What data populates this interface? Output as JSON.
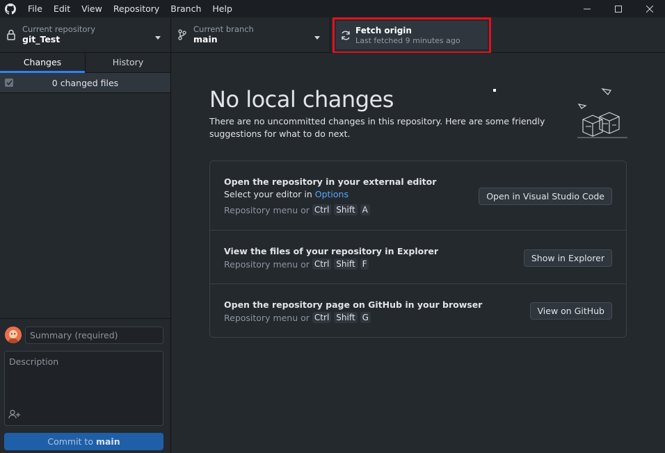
{
  "menu": [
    "File",
    "Edit",
    "View",
    "Repository",
    "Branch",
    "Help"
  ],
  "toolbar": {
    "repo_label": "Current repository",
    "repo_value": "git_Test",
    "branch_label": "Current branch",
    "branch_value": "main",
    "fetch_label": "Fetch origin",
    "fetch_sub": "Last fetched 9 minutes ago"
  },
  "sidebar": {
    "tabs": [
      "Changes",
      "History"
    ],
    "changed_files": "0 changed files",
    "summary_placeholder": "Summary (required)",
    "description_placeholder": "Description",
    "commit_prefix": "Commit to ",
    "commit_branch": "main"
  },
  "main": {
    "title": "No local changes",
    "subtitle": "There are no uncommitted changes in this repository. Here are some friendly suggestions for what to do next.",
    "suggestions": [
      {
        "title": "Open the repository in your external editor",
        "line_prefix": "Select your editor in ",
        "line_link": "Options",
        "menu_text": "Repository menu or",
        "keys": [
          "Ctrl",
          "Shift",
          "A"
        ],
        "button": "Open in Visual Studio Code"
      },
      {
        "title": "View the files of your repository in Explorer",
        "menu_text": "Repository menu or",
        "keys": [
          "Ctrl",
          "Shift",
          "F"
        ],
        "button": "Show in Explorer"
      },
      {
        "title": "Open the repository page on GitHub in your browser",
        "menu_text": "Repository menu or",
        "keys": [
          "Ctrl",
          "Shift",
          "G"
        ],
        "button": "View on GitHub"
      }
    ]
  },
  "icons": {
    "app": "github-logo-icon",
    "repo": "lock-icon",
    "branch": "branch-icon",
    "fetch": "sync-icon"
  },
  "colors": {
    "highlight": "#e3101c",
    "accent": "#2f81f7",
    "link": "#58a6ff",
    "commit_button": "#1f5fa8"
  }
}
